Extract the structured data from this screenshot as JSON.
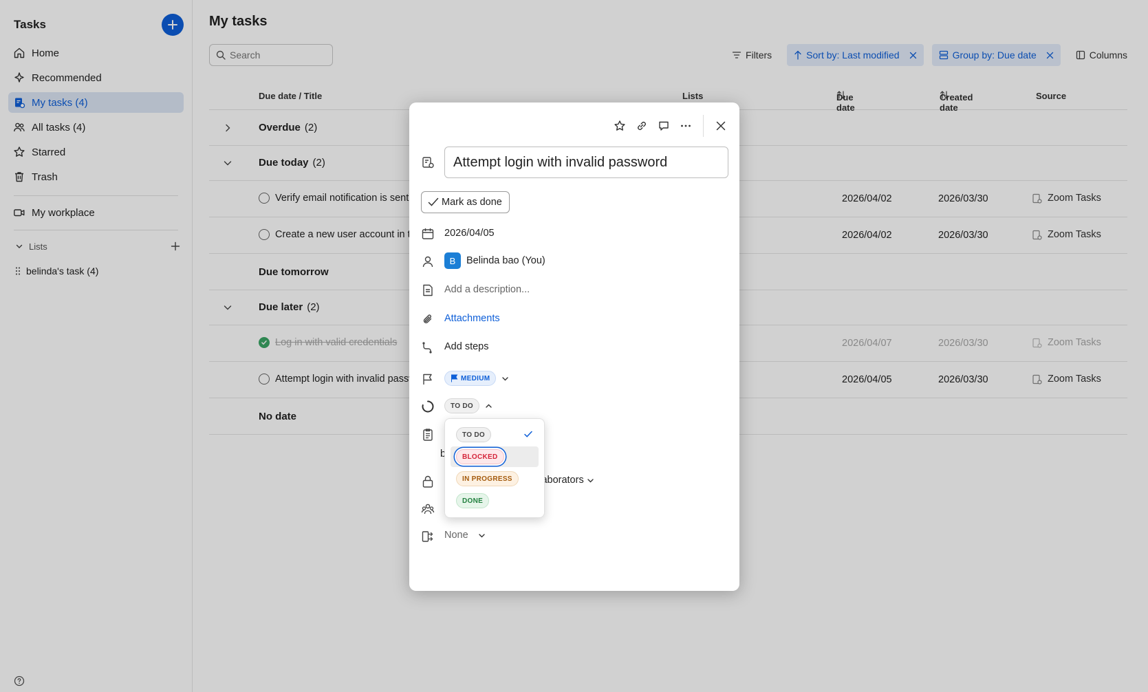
{
  "sidebar": {
    "title": "Tasks",
    "items": [
      {
        "label": "Home"
      },
      {
        "label": "Recommended"
      },
      {
        "label": "My tasks (4)"
      },
      {
        "label": "All tasks (4)"
      },
      {
        "label": "Starred"
      },
      {
        "label": "Trash"
      }
    ],
    "workplace": "My workplace",
    "lists_label": "Lists",
    "list_item": "belinda's task (4)"
  },
  "main": {
    "title": "My tasks",
    "search_placeholder": "Search",
    "toolbar": {
      "filters": "Filters",
      "sort": "Sort by: Last modified",
      "group": "Group by: Due date",
      "columns": "Columns"
    },
    "columns": {
      "title": "Due date / Title",
      "lists": "Lists",
      "due": "Due date",
      "created": "Created date",
      "source": "Source"
    },
    "groups": {
      "overdue": {
        "label": "Overdue",
        "count": "(2)"
      },
      "today": {
        "label": "Due today",
        "count": "(2)"
      },
      "tomorrow": {
        "label": "Due tomorrow"
      },
      "later": {
        "label": "Due later",
        "count": "(2)"
      },
      "nodate": {
        "label": "No date"
      }
    },
    "tasks": [
      {
        "title": "Verify email notification is sent",
        "due": "2026/04/02",
        "created": "2026/03/30",
        "source": "Zoom Tasks"
      },
      {
        "title": "Create a new user account in the system",
        "due": "2026/04/02",
        "created": "2026/03/30",
        "source": "Zoom Tasks"
      },
      {
        "title": "Log in with valid credentials",
        "due": "2026/04/07",
        "created": "2026/03/30",
        "source": "Zoom Tasks"
      },
      {
        "title": "Attempt login with invalid password",
        "due": "2026/04/05",
        "created": "2026/03/30",
        "source": "Zoom Tasks"
      }
    ]
  },
  "modal": {
    "title": "Attempt login with invalid password",
    "mark_done": "Mark as done",
    "due_date": "2026/04/05",
    "assignee_initial": "B",
    "assignee": "Belinda bao (You)",
    "description_placeholder": "Add a description...",
    "attachments": "Attachments",
    "add_steps": "Add steps",
    "priority": "MEDIUM",
    "status": "TO DO",
    "list_partial": "b",
    "visibility_partial": "llaborators",
    "dependency": "None"
  },
  "status_menu": {
    "options": [
      "TO DO",
      "BLOCKED",
      "IN PROGRESS",
      "DONE"
    ],
    "selected": "TO DO",
    "highlighted": "BLOCKED"
  },
  "colors": {
    "accent": "#0e5fd8",
    "blocked": "#d4243a",
    "in_progress": "#a45a0c",
    "done": "#22803f"
  }
}
